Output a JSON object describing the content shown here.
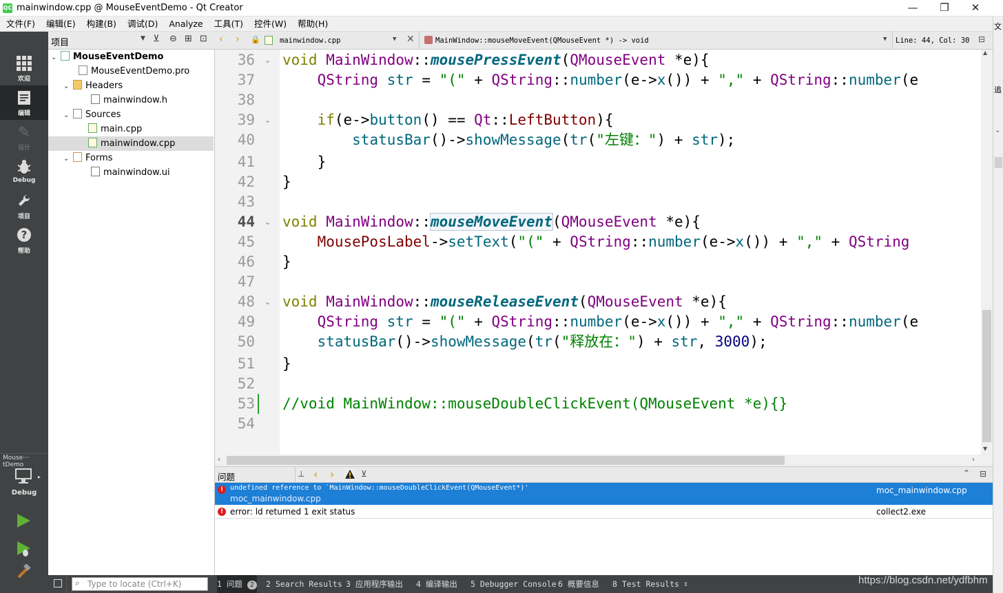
{
  "window": {
    "title": "mainwindow.cpp @ MouseEventDemo - Qt Creator",
    "logo": "QC"
  },
  "menus": [
    "文件(F)",
    "编辑(E)",
    "构建(B)",
    "调试(D)",
    "Analyze",
    "工具(T)",
    "控件(W)",
    "帮助(H)"
  ],
  "modes": [
    {
      "label": "欢迎",
      "icon": "grid-icon"
    },
    {
      "label": "编辑",
      "icon": "edit-icon"
    },
    {
      "label": "设计",
      "icon": "pencil-icon"
    },
    {
      "label": "Debug",
      "icon": "bug-icon"
    },
    {
      "label": "项目",
      "icon": "wrench-icon"
    },
    {
      "label": "帮助",
      "icon": "help-icon"
    }
  ],
  "kit": {
    "name": "Mouse⋯tDemo",
    "label": "Debug"
  },
  "project_panel": {
    "title": "项目",
    "tree": [
      {
        "label": "MouseEventDemo",
        "bold": true,
        "level": 0,
        "expanded": true
      },
      {
        "label": "MouseEventDemo.pro",
        "level": 1
      },
      {
        "label": "Headers",
        "level": 1,
        "expanded": true
      },
      {
        "label": "mainwindow.h",
        "level": 2
      },
      {
        "label": "Sources",
        "level": 1,
        "expanded": true
      },
      {
        "label": "main.cpp",
        "level": 2
      },
      {
        "label": "mainwindow.cpp",
        "level": 2,
        "selected": true
      },
      {
        "label": "Forms",
        "level": 1,
        "expanded": true
      },
      {
        "label": "mainwindow.ui",
        "level": 2
      }
    ]
  },
  "editor": {
    "file_tab": "mainwindow.cpp",
    "symbol": "MainWindow::mouseMoveEvent(QMouseEvent *) -> void",
    "position": "Line: 44, Col: 30",
    "current_line": 44,
    "line_numbers": [
      "36",
      "37",
      "38",
      "39",
      "40",
      "41",
      "42",
      "43",
      "44",
      "45",
      "46",
      "47",
      "48",
      "49",
      "50",
      "51",
      "52",
      "53",
      "54"
    ],
    "fold_lines": [
      "36",
      "39",
      "44",
      "48"
    ]
  },
  "issues": {
    "title": "问题",
    "rows": [
      {
        "message": "undefined reference to `MainWindow::mouseDoubleClickEvent(QMouseEvent*)'",
        "file": "moc_mainwindow.cpp",
        "location": "moc_mainwindow.cpp",
        "selected": true
      },
      {
        "message": "error: ld returned 1 exit status",
        "file": "",
        "location": "collect2.exe",
        "selected": false
      }
    ]
  },
  "bottom": {
    "locator_placeholder": "Type to locate (Ctrl+K)",
    "tabs": [
      "1 问题",
      "2 Search Results",
      "3 应用程序输出",
      "4 编译输出",
      "5 Debugger Console",
      "6 概要信息",
      "8 Test Results"
    ],
    "issues_count": "2"
  },
  "watermark": "https://blog.csdn.net/ydfbhm",
  "right_strip": [
    "追",
    "文"
  ]
}
